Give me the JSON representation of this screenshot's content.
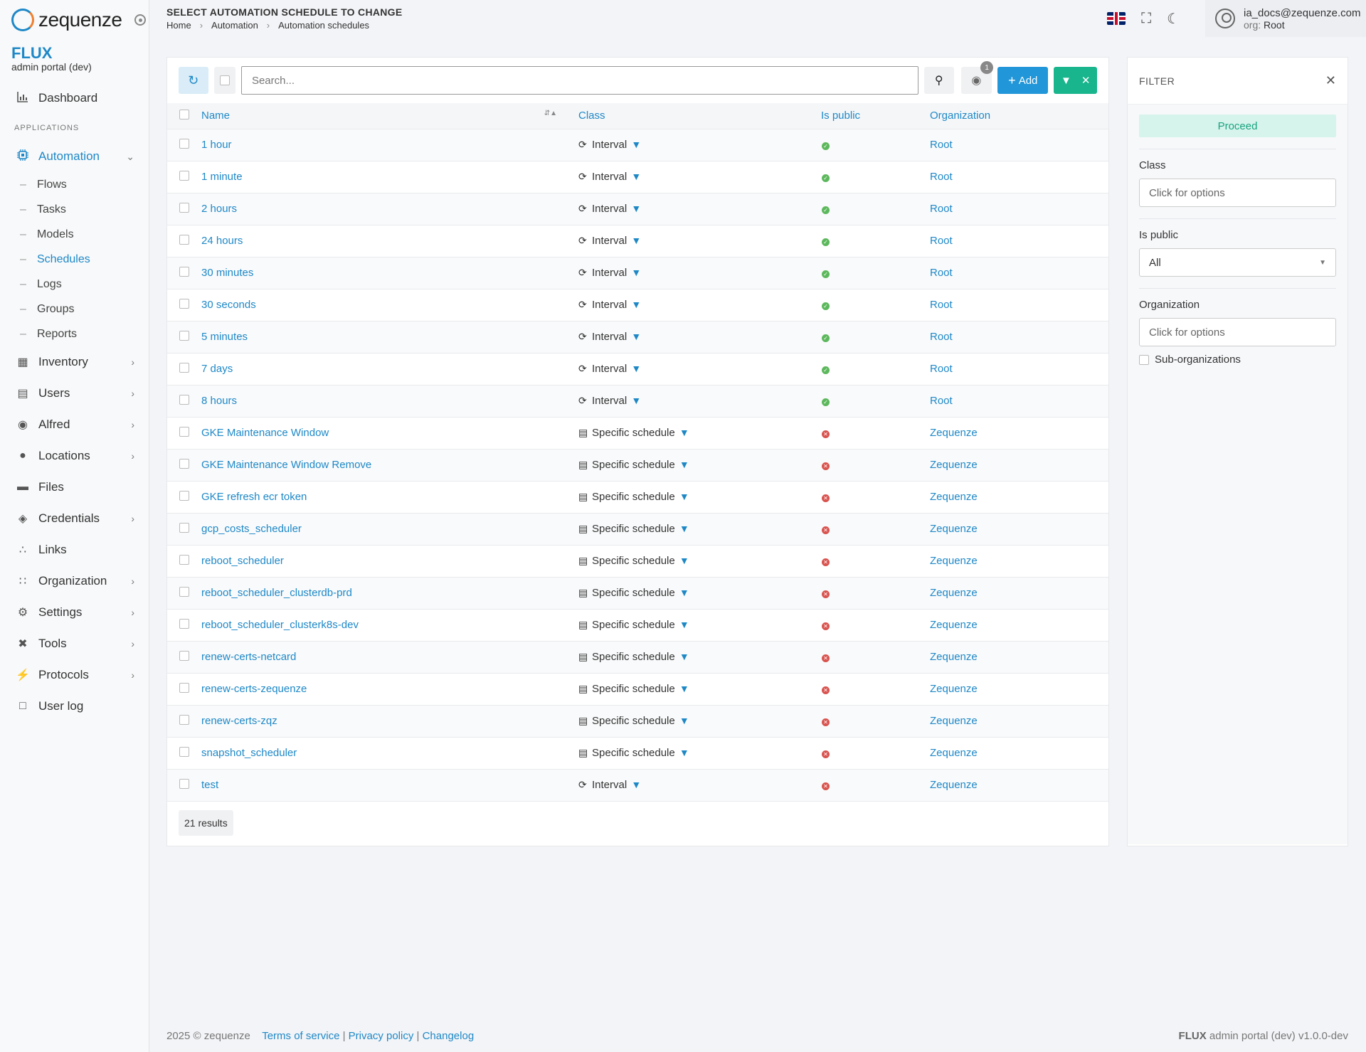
{
  "app": {
    "logo_text": "zequenze",
    "brand_name": "FLUX",
    "brand_sub": "admin portal (dev)"
  },
  "sidebar": {
    "dashboard": "Dashboard",
    "section_label": "APPLICATIONS",
    "automation": "Automation",
    "automation_items": [
      "Flows",
      "Tasks",
      "Models",
      "Schedules",
      "Logs",
      "Groups",
      "Reports"
    ],
    "items": [
      {
        "label": "Inventory",
        "icon": "inventory-icon"
      },
      {
        "label": "Users",
        "icon": "users-icon"
      },
      {
        "label": "Alfred",
        "icon": "robot-icon"
      },
      {
        "label": "Locations",
        "icon": "location-icon"
      },
      {
        "label": "Files",
        "icon": "folder-icon"
      },
      {
        "label": "Credentials",
        "icon": "shield-icon"
      },
      {
        "label": "Links",
        "icon": "share-icon"
      },
      {
        "label": "Organization",
        "icon": "sitemap-icon"
      },
      {
        "label": "Settings",
        "icon": "cogs-icon"
      },
      {
        "label": "Tools",
        "icon": "tools-icon"
      },
      {
        "label": "Protocols",
        "icon": "plug-icon"
      },
      {
        "label": "User log",
        "icon": "calendar-icon"
      }
    ]
  },
  "header": {
    "title": "SELECT AUTOMATION SCHEDULE TO CHANGE",
    "breadcrumb": [
      "Home",
      "Automation",
      "Automation schedules"
    ],
    "user_email": "ia_docs@zequenze.com",
    "org_label": "org:",
    "org_value": "Root"
  },
  "toolbar": {
    "search_placeholder": "Search...",
    "eye_badge": "1",
    "add_label": "Add"
  },
  "table": {
    "columns": [
      "Name",
      "Class",
      "Is public",
      "Organization"
    ],
    "rows": [
      {
        "name": "1 hour",
        "class": "Interval",
        "public": true,
        "org": "Root"
      },
      {
        "name": "1 minute",
        "class": "Interval",
        "public": true,
        "org": "Root"
      },
      {
        "name": "2 hours",
        "class": "Interval",
        "public": true,
        "org": "Root"
      },
      {
        "name": "24 hours",
        "class": "Interval",
        "public": true,
        "org": "Root"
      },
      {
        "name": "30 minutes",
        "class": "Interval",
        "public": true,
        "org": "Root"
      },
      {
        "name": "30 seconds",
        "class": "Interval",
        "public": true,
        "org": "Root"
      },
      {
        "name": "5 minutes",
        "class": "Interval",
        "public": true,
        "org": "Root"
      },
      {
        "name": "7 days",
        "class": "Interval",
        "public": true,
        "org": "Root"
      },
      {
        "name": "8 hours",
        "class": "Interval",
        "public": true,
        "org": "Root"
      },
      {
        "name": "GKE Maintenance Window",
        "class": "Specific schedule",
        "public": false,
        "org": "Zequenze"
      },
      {
        "name": "GKE Maintenance Window Remove",
        "class": "Specific schedule",
        "public": false,
        "org": "Zequenze"
      },
      {
        "name": "GKE refresh ecr token",
        "class": "Specific schedule",
        "public": false,
        "org": "Zequenze"
      },
      {
        "name": "gcp_costs_scheduler",
        "class": "Specific schedule",
        "public": false,
        "org": "Zequenze"
      },
      {
        "name": "reboot_scheduler",
        "class": "Specific schedule",
        "public": false,
        "org": "Zequenze"
      },
      {
        "name": "reboot_scheduler_clusterdb-prd",
        "class": "Specific schedule",
        "public": false,
        "org": "Zequenze"
      },
      {
        "name": "reboot_scheduler_clusterk8s-dev",
        "class": "Specific schedule",
        "public": false,
        "org": "Zequenze"
      },
      {
        "name": "renew-certs-netcard",
        "class": "Specific schedule",
        "public": false,
        "org": "Zequenze"
      },
      {
        "name": "renew-certs-zequenze",
        "class": "Specific schedule",
        "public": false,
        "org": "Zequenze"
      },
      {
        "name": "renew-certs-zqz",
        "class": "Specific schedule",
        "public": false,
        "org": "Zequenze"
      },
      {
        "name": "snapshot_scheduler",
        "class": "Specific schedule",
        "public": false,
        "org": "Zequenze"
      },
      {
        "name": "test",
        "class": "Interval",
        "public": false,
        "org": "Zequenze"
      }
    ],
    "results": "21 results"
  },
  "filter": {
    "title": "FILTER",
    "proceed": "Proceed",
    "class_label": "Class",
    "class_placeholder": "Click for options",
    "public_label": "Is public",
    "public_value": "All",
    "org_label": "Organization",
    "org_placeholder": "Click for options",
    "suborg_label": "Sub-organizations"
  },
  "footer": {
    "copyright": "2025 © zequenze",
    "links": [
      "Terms of service",
      "Privacy policy",
      "Changelog"
    ],
    "version_brand": "FLUX",
    "version_text": "admin portal (dev) v1.0.0-dev"
  }
}
